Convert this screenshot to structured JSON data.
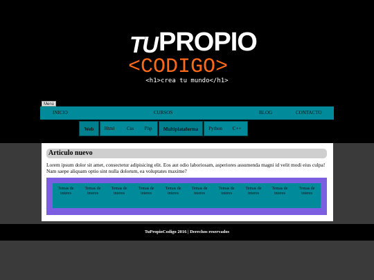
{
  "logo": {
    "tu": "TU",
    "propio": "PROPIO",
    "codigo": "<CODIGO>"
  },
  "tagline": "<h1>crea tu mundo</h1>",
  "menu_toggle": "Menú",
  "main_nav": [
    "INICIO",
    "CURSOS",
    "BLOG",
    "CONTACTO"
  ],
  "sub_nav": [
    "Web",
    "Html",
    "Css",
    "Php",
    "Multiplataforma",
    "Python",
    "C++"
  ],
  "article": {
    "title": "Articulo nuevo",
    "text": "Lorem ipsum dolor sit amet, consectetur adipisicing elit. Eos aut odio laboriosam, asperiores assumenda magni id velit modi eius culpa! Nam saepe aliquam optio sint nulla dolorum, ea voluptates maxime?"
  },
  "topics": [
    "Temas de interes",
    "Temas de interes",
    "Temas de interes",
    "Temas de interes",
    "Temas de interes",
    "Temas de interes",
    "Temas de interes",
    "Temas de interes",
    "Temas de interes",
    "Temas de interes"
  ],
  "footer": "TuPropioCodigo 2016 | Derechos reservados",
  "colors": {
    "accent_teal": "#008a9a",
    "purple": "#7b5fe0",
    "orange": "#ff6a1a"
  }
}
